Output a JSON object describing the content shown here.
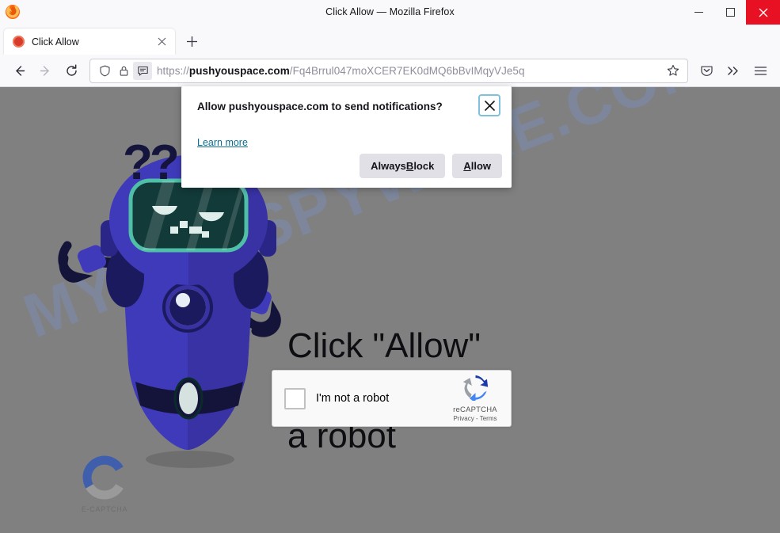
{
  "window": {
    "title": "Click Allow — Mozilla Firefox",
    "controls": {
      "minimize": "minimize",
      "maximize": "maximize",
      "close": "close"
    }
  },
  "tabs": [
    {
      "title": "Click Allow",
      "favicon_color": "#d63b2b",
      "close_label": "×"
    }
  ],
  "newtab_label": "+",
  "toolbar": {
    "back_label": "Back",
    "forward_label": "Forward",
    "reload_label": "Reload",
    "url_scheme": "https://",
    "url_host": "pushyouspace.com",
    "url_path": "/Fq4Brrul047moXCER7EK0dMQ6bBvIMqyVJe5q",
    "bookmark_label": "Bookmark this page",
    "pocket_label": "Save to Pocket",
    "overflow_label": "More tools",
    "menu_label": "Open application menu"
  },
  "doorhanger": {
    "title": "Allow pushyouspace.com to send notifications?",
    "learn_more": "Learn more",
    "close_label": "×",
    "buttons": [
      {
        "label_pre": "Always ",
        "accesskey": "B",
        "label_post": "lock",
        "name": "always-block"
      },
      {
        "label_pre": "",
        "accesskey": "A",
        "label_post": "llow",
        "name": "allow"
      }
    ],
    "focus_ring_color": "#7fc0da"
  },
  "page": {
    "background_color": "#808080",
    "watermark": "MYANTISPYWARE.COM",
    "watermark_color": "#7896dc",
    "headline_line1": "Click \"Allow\"",
    "headline_line2": "a robot",
    "question_marks": "??",
    "ecaptcha_label": "E-CAPTCHA",
    "ecaptcha_colors": {
      "blue": "#3f5fad",
      "gray": "#9a9a9a"
    },
    "robot_colors": {
      "body": "#3a35a0",
      "body_dark": "#2a2580",
      "screen": "#123a38",
      "screen_border": "#4fbfa8",
      "accent_dark": "#121233"
    }
  },
  "recaptcha": {
    "checkbox_label": "I'm not a robot",
    "brand_name": "reCAPTCHA",
    "legal": "Privacy - Terms",
    "logo_blue": "#1c3aa9",
    "logo_gray": "#9aa0a6"
  }
}
